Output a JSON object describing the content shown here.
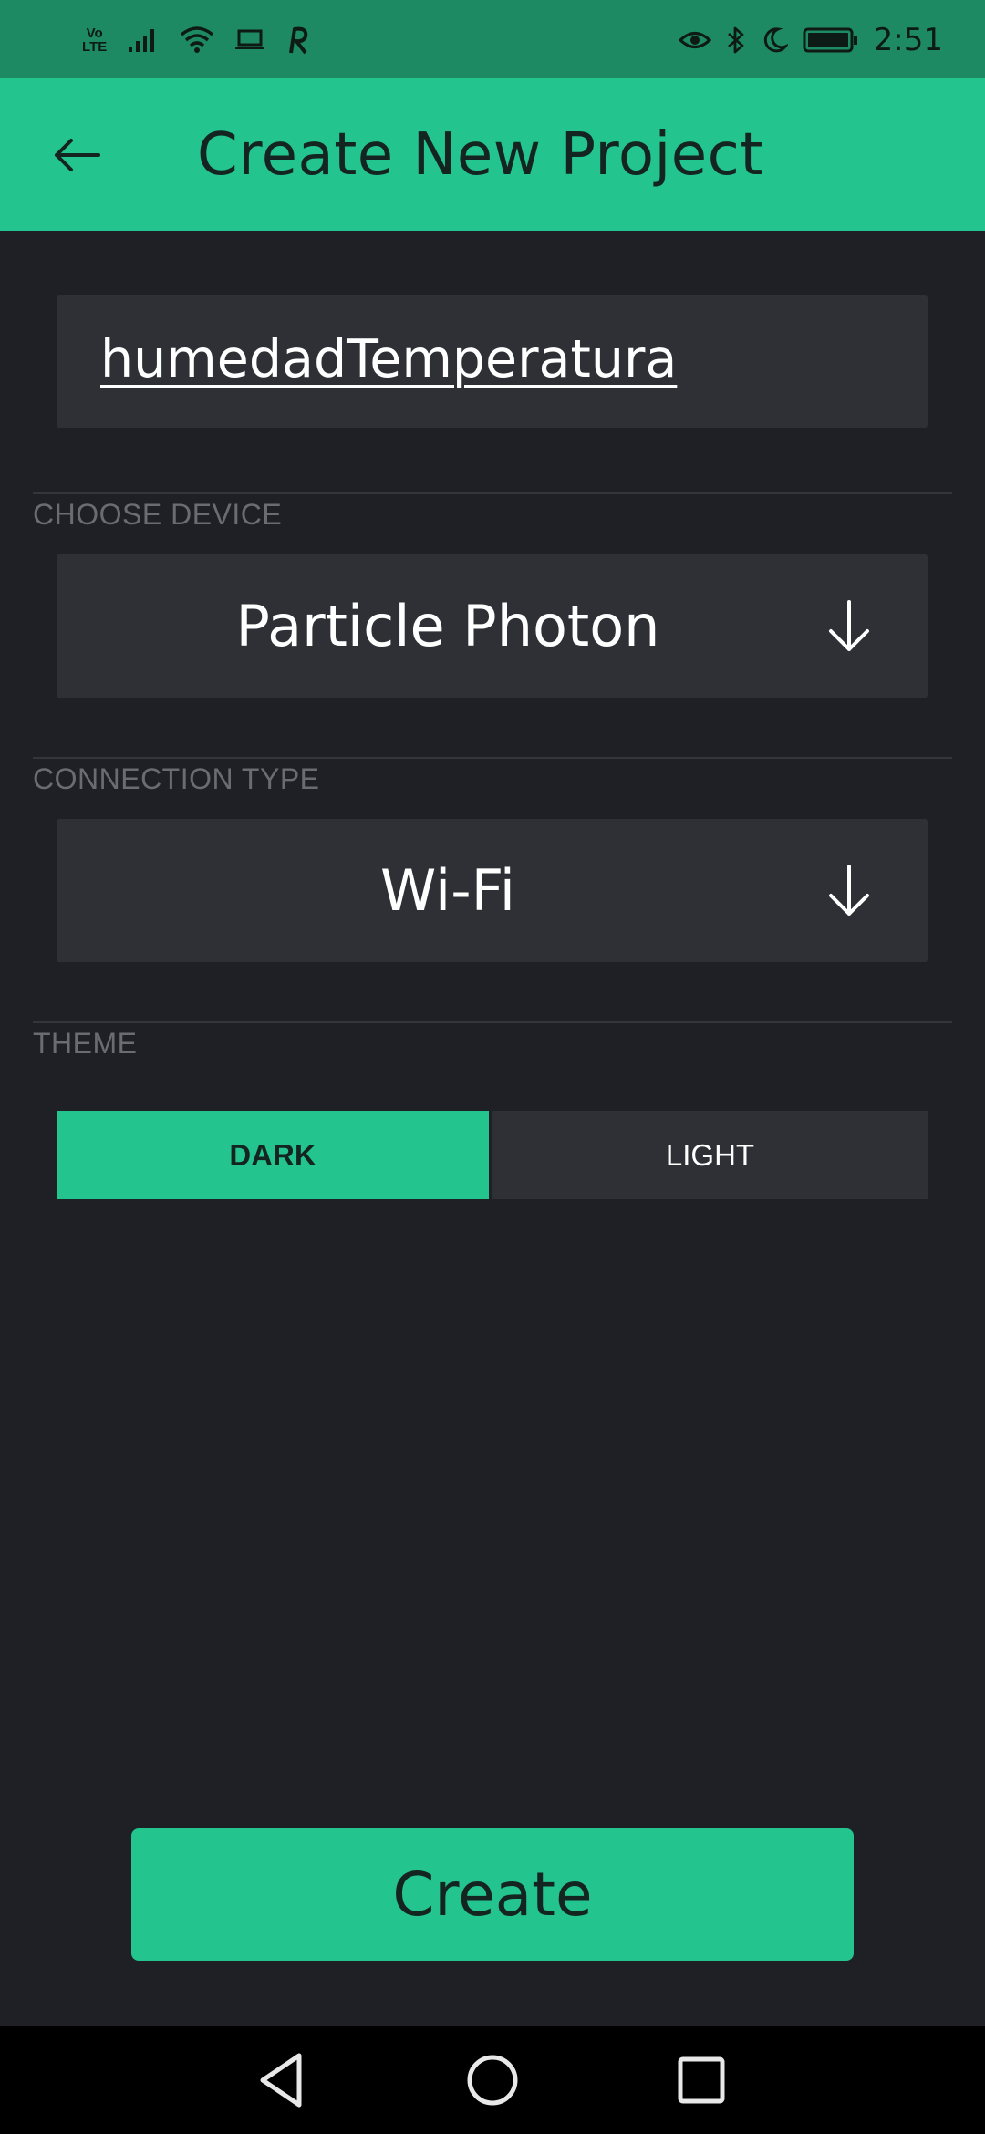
{
  "status_bar": {
    "volte_top": "Vo",
    "volte_bottom": "LTE",
    "time": "2:51",
    "icons": [
      "volte-icon",
      "signal-icon",
      "wifi-icon",
      "laptop-icon",
      "r-app-icon",
      "eye-icon",
      "bluetooth-icon",
      "moon-icon",
      "battery-icon"
    ]
  },
  "app_bar": {
    "title": "Create New Project",
    "back_icon": "arrow-left-icon"
  },
  "form": {
    "project_name": "humedadTemperatura",
    "device_section_label": "CHOOSE DEVICE",
    "device_value": "Particle Photon",
    "connection_section_label": "CONNECTION TYPE",
    "connection_value": "Wi-Fi",
    "theme_section_label": "THEME",
    "theme_options": [
      "DARK",
      "LIGHT"
    ],
    "theme_selected": "DARK",
    "dropdown_icon": "arrow-down-icon"
  },
  "actions": {
    "create_label": "Create"
  },
  "nav_bar": {
    "icons": [
      "back-triangle-icon",
      "home-circle-icon",
      "recents-square-icon"
    ]
  },
  "colors": {
    "accent": "#23c48e",
    "status_bar": "#1e8a64",
    "background": "#1f2025",
    "field": "#2e3036",
    "label": "#6a6c71"
  }
}
